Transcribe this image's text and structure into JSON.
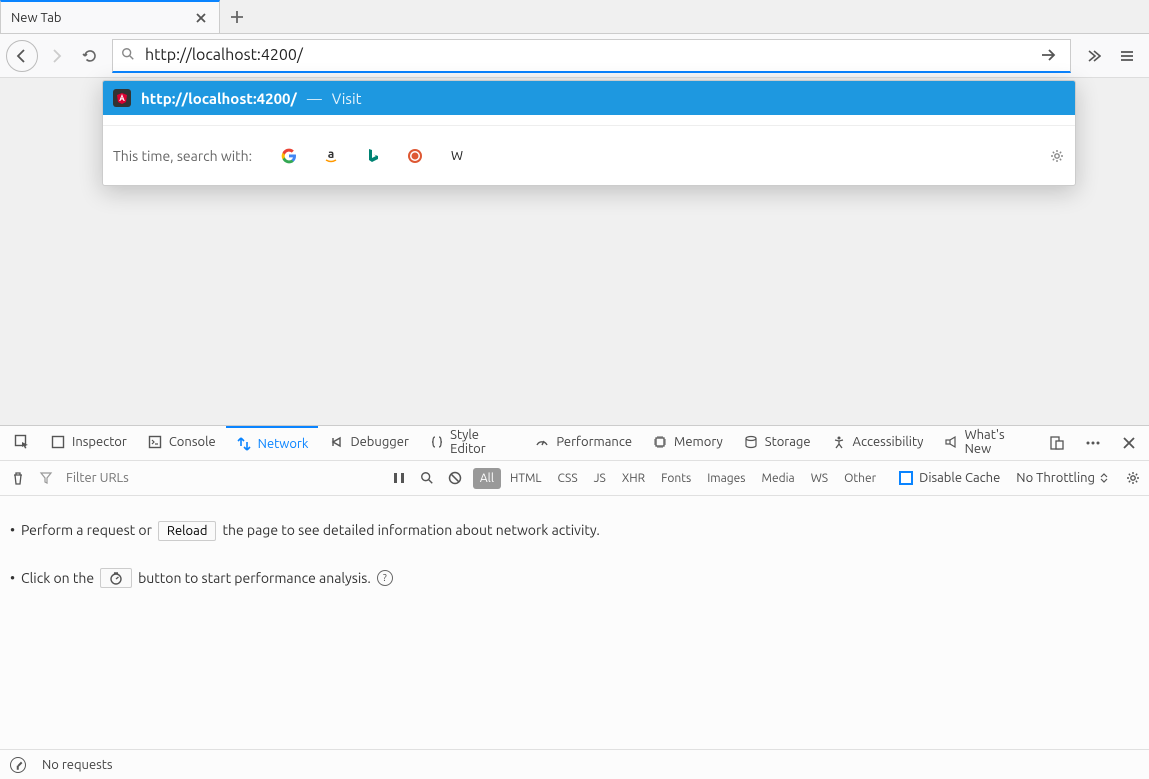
{
  "tabs": {
    "active_title": "New Tab"
  },
  "urlbar": {
    "value": "http://localhost:4200/"
  },
  "suggestion": {
    "url": "http://localhost:4200/",
    "dash": "—",
    "action": "Visit"
  },
  "search_with": {
    "label": "This time, search with:"
  },
  "devtools": {
    "tabs": {
      "inspector": "Inspector",
      "console": "Console",
      "network": "Network",
      "debugger": "Debugger",
      "style_editor": "Style Editor",
      "performance": "Performance",
      "memory": "Memory",
      "storage": "Storage",
      "accessibility": "Accessibility",
      "whats_new": "What's New"
    },
    "filter_placeholder": "Filter URLs",
    "type_filters": [
      "All",
      "HTML",
      "CSS",
      "JS",
      "XHR",
      "Fonts",
      "Images",
      "Media",
      "WS",
      "Other"
    ],
    "disable_cache": "Disable Cache",
    "throttling": "No Throttling",
    "body": {
      "line1_a": "Perform a request or",
      "reload": "Reload",
      "line1_b": "the page to see detailed information about network activity.",
      "line2_a": "Click on the",
      "line2_b": "button to start performance analysis."
    },
    "status": {
      "requests": "No requests"
    }
  }
}
